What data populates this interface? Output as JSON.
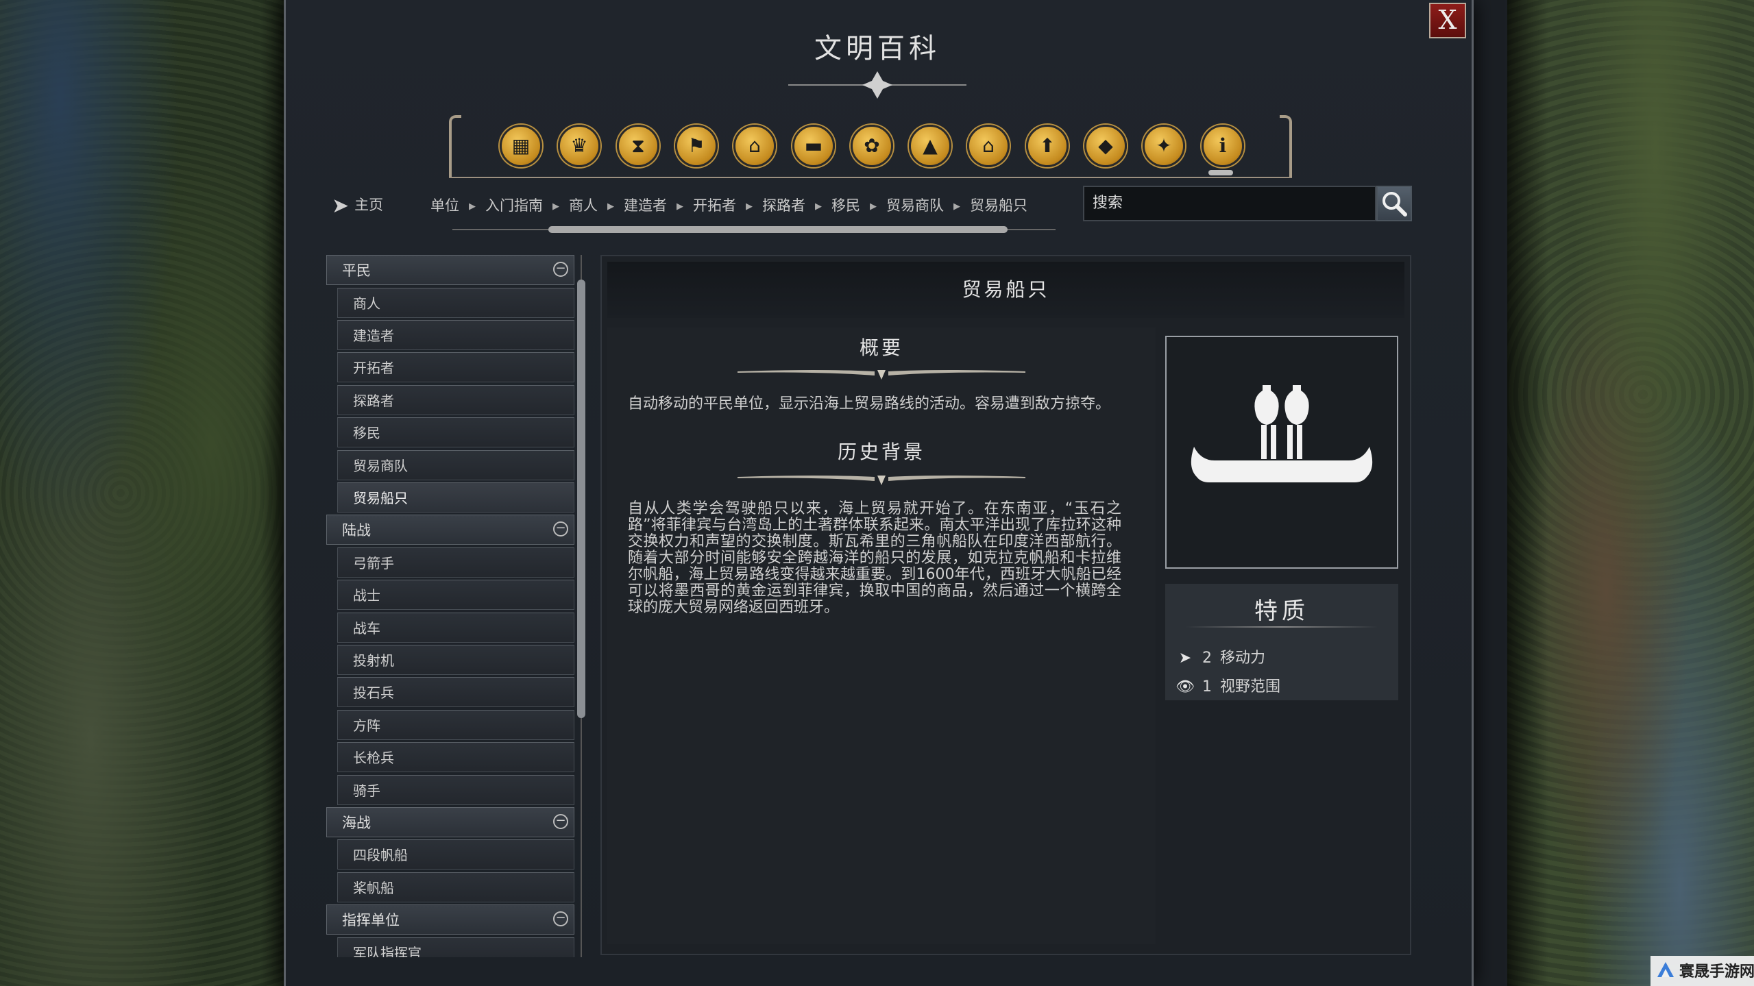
{
  "window": {
    "title": "文明百科",
    "close_label": "X"
  },
  "category_icons": [
    {
      "name": "civilizations-icon",
      "glyph": "▦"
    },
    {
      "name": "leaders-icon",
      "glyph": "♛"
    },
    {
      "name": "ages-icon",
      "glyph": "⧗"
    },
    {
      "name": "flag-icon",
      "glyph": "⚑"
    },
    {
      "name": "government-icon",
      "glyph": "⌂"
    },
    {
      "name": "book-icon",
      "glyph": "▬"
    },
    {
      "name": "resources-icon",
      "glyph": "✿"
    },
    {
      "name": "terrain-icon",
      "glyph": "▲"
    },
    {
      "name": "buildings-icon",
      "glyph": "⌂"
    },
    {
      "name": "units-icon",
      "glyph": "⬆"
    },
    {
      "name": "wonders-icon",
      "glyph": "◆"
    },
    {
      "name": "religion-icon",
      "glyph": "✦"
    },
    {
      "name": "info-icon",
      "glyph": "i"
    }
  ],
  "nav": {
    "home_label": "主页",
    "breadcrumbs": [
      "单位",
      "入门指南",
      "商人",
      "建造者",
      "开拓者",
      "探路者",
      "移民",
      "贸易商队",
      "贸易船只"
    ],
    "search_placeholder": "搜索"
  },
  "list": {
    "groups": [
      {
        "label": "平民",
        "items": [
          "商人",
          "建造者",
          "开拓者",
          "探路者",
          "移民",
          "贸易商队",
          "贸易船只"
        ]
      },
      {
        "label": "陆战",
        "items": [
          "弓箭手",
          "战士",
          "战车",
          "投射机",
          "投石兵",
          "方阵",
          "长枪兵",
          "骑手"
        ]
      },
      {
        "label": "海战",
        "items": [
          "四段帆船",
          "桨帆船"
        ]
      },
      {
        "label": "指挥单位",
        "items": [
          "军队指挥官"
        ]
      }
    ],
    "selected": "贸易船只"
  },
  "detail": {
    "title": "贸易船只",
    "summary_title": "概要",
    "summary_text": "自动移动的平民单位，显示沿海上贸易路线的活动。容易遭到敌方掠夺。",
    "history_title": "历史背景",
    "history_text": "自从人类学会驾驶船只以来，海上贸易就开始了。在东南亚，“玉石之路”将菲律宾与台湾岛上的土著群体联系起来。南太平洋出现了库拉环这种交换权力和声望的交换制度。斯瓦希里的三角帆船队在印度洋西部航行。随着大部分时间能够安全跨越海洋的船只的发展，如克拉克帆船和卡拉维尔帆船，海上贸易路线变得越来越重要。到1600年代，西班牙大帆船已经可以将墨西哥的黄金运到菲律宾，换取中国的商品，然后通过一个横跨全球的庞大贸易网络返回西班牙。",
    "portrait_icon": "trade-ship-icon",
    "traits_title": "特质",
    "traits": [
      {
        "icon": "movement-icon",
        "glyph": "➤",
        "value": "2",
        "label": "移动力"
      },
      {
        "icon": "sight-icon",
        "glyph": "👁",
        "value": "1",
        "label": "视野范围"
      }
    ]
  },
  "watermark": {
    "text": "寰晟手游网"
  }
}
